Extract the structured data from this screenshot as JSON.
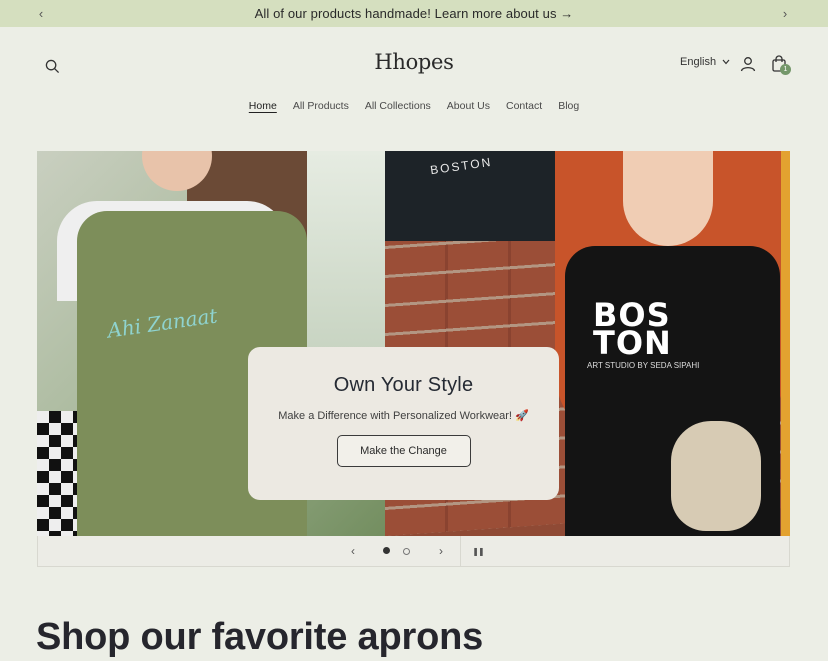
{
  "announcement": {
    "text": "All of our products handmade! Learn more about us →",
    "prev_icon": "‹",
    "next_icon": "›"
  },
  "header": {
    "logo": "Hhopes",
    "language": "English",
    "cart_count": "1",
    "icons": [
      "search-icon",
      "account-icon",
      "cart-icon",
      "chevron-down-icon"
    ]
  },
  "nav": {
    "items": [
      {
        "label": "Home"
      },
      {
        "label": "All Products"
      },
      {
        "label": "All Collections"
      },
      {
        "label": "About Us"
      },
      {
        "label": "Contact"
      },
      {
        "label": "Blog"
      }
    ],
    "active": "Home"
  },
  "hero": {
    "slide": {
      "title": "Own Your Style",
      "subtitle": "Make a Difference with Personalized Workwear! 🚀",
      "button": "Make the Change"
    },
    "left_apron_text": "Ahi Zanaat",
    "right_poster_text": "BOSTON",
    "right_apron_text": "BOS TON",
    "right_apron_subtext": "ART STUDIO BY SEDA SIPAHI",
    "slides_total": 2,
    "active_slide": 1
  },
  "slider_controls": {
    "prev_icon": "‹",
    "next_icon": "›",
    "pause_icon": "❚❚"
  },
  "section": {
    "title": "Shop our favorite aprons"
  },
  "colors": {
    "announcement_bg": "#d5dfbf",
    "page_bg": "#eceee6",
    "accent": "#74976a"
  }
}
